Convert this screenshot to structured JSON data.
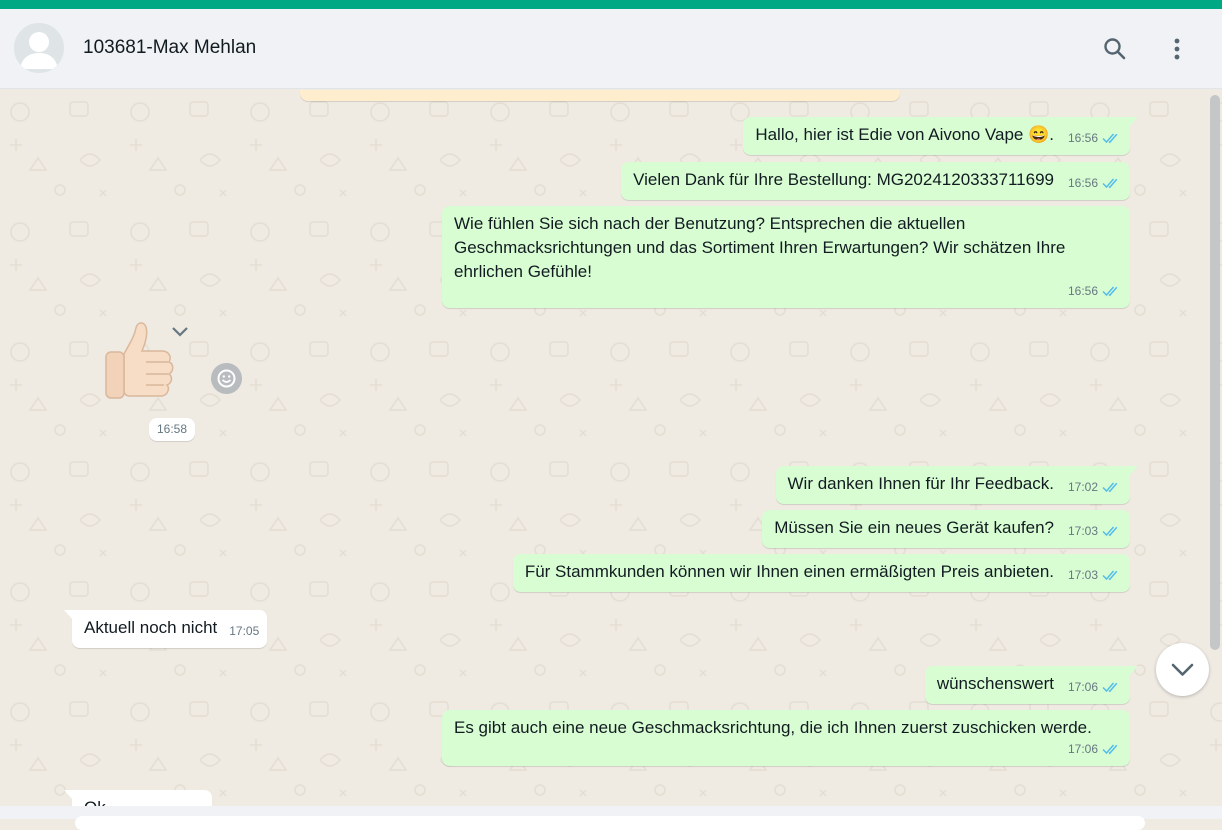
{
  "colors": {
    "accent": "#00a884",
    "outgoing_bubble": "#d9fdd3",
    "incoming_bubble": "#ffffff",
    "chat_background": "#efeae2",
    "read_ticks": "#53bdeb"
  },
  "header": {
    "contact_name": "103681-Max Mehlan",
    "avatar_icon": "default-avatar-icon",
    "search_icon": "search-icon",
    "menu_icon": "more-vertical-icon"
  },
  "messages": [
    {
      "direction": "out",
      "text": "Hallo, hier ist Edie von Aivono Vape 😄.",
      "time": "16:56",
      "status": "read"
    },
    {
      "direction": "out",
      "text": "Vielen Dank für Ihre Bestellung: MG2024120333711699",
      "time": "16:56",
      "status": "read"
    },
    {
      "direction": "out",
      "text": "Wie fühlen Sie sich nach der Benutzung? Entsprechen die aktuellen Geschmacksrichtungen und das Sortiment Ihren Erwartungen? Wir schätzen Ihre ehrlichen Gefühle!",
      "time": "16:56",
      "status": "read"
    },
    {
      "direction": "in",
      "type": "sticker",
      "sticker": "thumbs-up",
      "time": "16:58"
    },
    {
      "direction": "out",
      "text": "Wir danken Ihnen für Ihr Feedback.",
      "time": "17:02",
      "status": "read"
    },
    {
      "direction": "out",
      "text": "Müssen Sie ein neues Gerät kaufen?",
      "time": "17:03",
      "status": "read"
    },
    {
      "direction": "out",
      "text": "Für Stammkunden können wir Ihnen einen ermäßigten Preis anbieten.",
      "time": "17:03",
      "status": "read"
    },
    {
      "direction": "in",
      "text": "Aktuell noch nicht",
      "time": "17:05"
    },
    {
      "direction": "out",
      "text": "wünschenswert",
      "time": "17:06",
      "status": "read"
    },
    {
      "direction": "out",
      "text": "Es gibt auch eine neue Geschmacksrichtung, die ich Ihnen zuerst zuschicken werde.",
      "time": "17:06",
      "status": "read"
    },
    {
      "direction": "in",
      "text": "Ok",
      "time": "",
      "partially_visible": true
    }
  ]
}
